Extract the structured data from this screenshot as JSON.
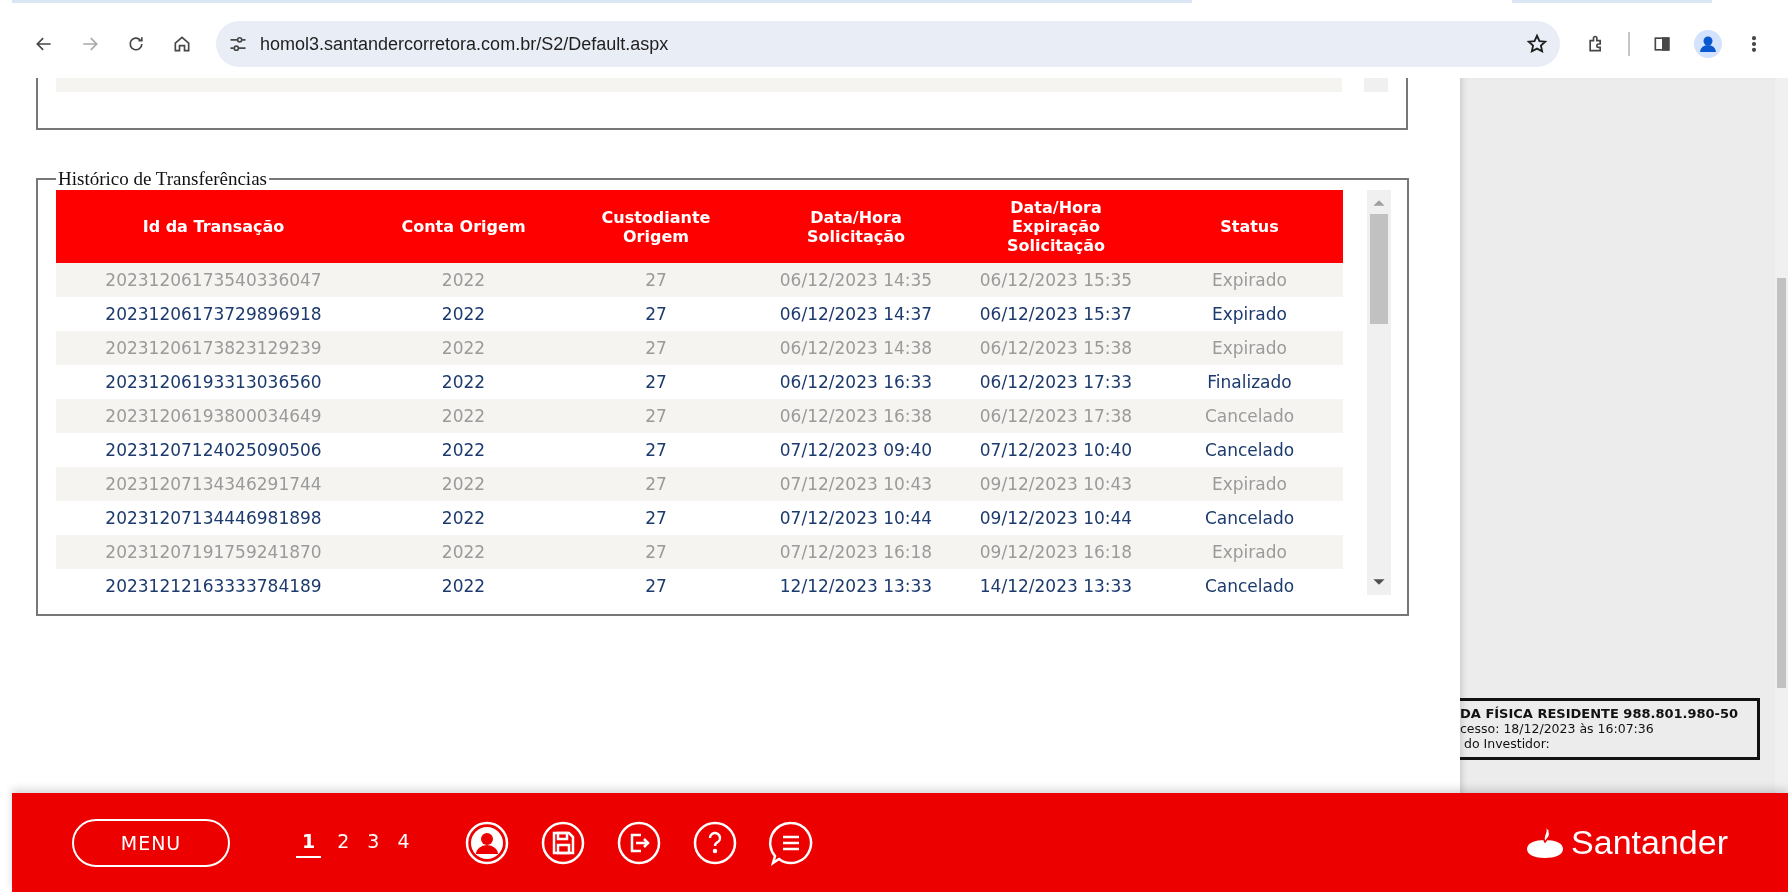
{
  "browser": {
    "url": "homol3.santandercorretora.com.br/S2/Default.aspx"
  },
  "history": {
    "title": "Histórico de Transferências",
    "columns": [
      "Id da Transação",
      "Conta Origem",
      "Custodiante Origem",
      "Data/Hora Solicitação",
      "Data/Hora Expiração Solicitação",
      "Status"
    ],
    "rows": [
      {
        "muted": true,
        "cells": [
          "20231206173540336047",
          "2022",
          "27",
          "06/12/2023 14:35",
          "06/12/2023 15:35",
          "Expirado"
        ]
      },
      {
        "muted": false,
        "cells": [
          "20231206173729896918",
          "2022",
          "27",
          "06/12/2023 14:37",
          "06/12/2023 15:37",
          "Expirado"
        ]
      },
      {
        "muted": true,
        "cells": [
          "20231206173823129239",
          "2022",
          "27",
          "06/12/2023 14:38",
          "06/12/2023 15:38",
          "Expirado"
        ]
      },
      {
        "muted": false,
        "cells": [
          "20231206193313036560",
          "2022",
          "27",
          "06/12/2023 16:33",
          "06/12/2023 17:33",
          "Finalizado"
        ]
      },
      {
        "muted": true,
        "cells": [
          "20231206193800034649",
          "2022",
          "27",
          "06/12/2023 16:38",
          "06/12/2023 17:38",
          "Cancelado"
        ]
      },
      {
        "muted": false,
        "cells": [
          "20231207124025090506",
          "2022",
          "27",
          "07/12/2023 09:40",
          "07/12/2023 10:40",
          "Cancelado"
        ]
      },
      {
        "muted": true,
        "cells": [
          "20231207134346291744",
          "2022",
          "27",
          "07/12/2023 10:43",
          "09/12/2023 10:43",
          "Expirado"
        ]
      },
      {
        "muted": false,
        "cells": [
          "20231207134446981898",
          "2022",
          "27",
          "07/12/2023 10:44",
          "09/12/2023 10:44",
          "Cancelado"
        ]
      },
      {
        "muted": true,
        "cells": [
          "20231207191759241870",
          "2022",
          "27",
          "07/12/2023 16:18",
          "09/12/2023 16:18",
          "Expirado"
        ]
      },
      {
        "muted": false,
        "cells": [
          "20231212163333784189",
          "2022",
          "27",
          "12/12/2023 13:33",
          "14/12/2023 13:33",
          "Cancelado"
        ]
      }
    ]
  },
  "info_box": [
    "DA FÍSICA RESIDENTE 988.801.980-50",
    "cesso: 18/12/2023 às 16:07:36",
    " do Investidor:"
  ],
  "footer": {
    "menu": "MENU",
    "pages": [
      {
        "label": "1",
        "selected": true
      },
      {
        "label": "2",
        "selected": false
      },
      {
        "label": "3",
        "selected": false
      },
      {
        "label": "4",
        "selected": false
      }
    ],
    "brand": "Santander"
  }
}
